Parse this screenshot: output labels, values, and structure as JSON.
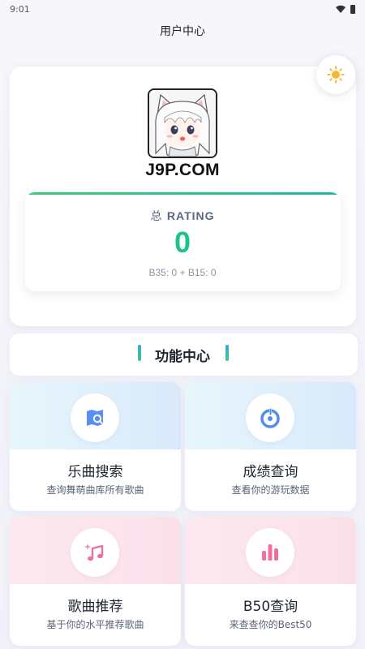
{
  "status": {
    "time": "9:01"
  },
  "header": {
    "title": "用户中心"
  },
  "profile": {
    "theme_icon": "sun-icon",
    "avatar_icon": "anime-cat-girl-avatar",
    "username": "J9P.COM",
    "rating_prefix": "总",
    "rating_word": "RATING",
    "rating_value": "0",
    "rating_breakdown": "B35: 0 + B15: 0"
  },
  "section": {
    "title": "功能中心"
  },
  "features": [
    {
      "title": "乐曲搜索",
      "desc": "查询舞萌曲库所有歌曲",
      "icon": "map-search-icon"
    },
    {
      "title": "成绩查询",
      "desc": "查看你的游玩数据",
      "icon": "record-disc-icon"
    },
    {
      "title": "歌曲推荐",
      "desc": "基于你的水平推荐歌曲",
      "icon": "music-sparkle-icon"
    },
    {
      "title": "B50查询",
      "desc": "来查查你的Best50",
      "icon": "bar-chart-icon"
    }
  ],
  "colors": {
    "accent_green": "#1ec28b",
    "icon_blue": "#4f8df0",
    "icon_pink": "#f06fa0"
  }
}
